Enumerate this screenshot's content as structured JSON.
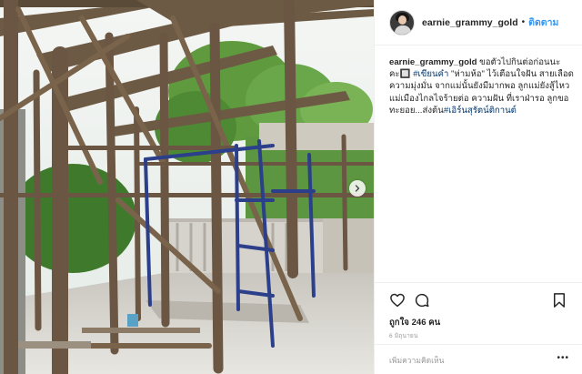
{
  "post": {
    "username": "earnie_grammy_gold",
    "separator": "•",
    "follow_label": "ติดตาม",
    "caption": {
      "user": "earnie_grammy_gold",
      "text_1": " ขอตัวไปกินต่อก่อนนะคะ🔲 ",
      "tag_1": "#เขียนคำ",
      "text_2": " \"ห่ามห้อ\" ไว้เตือนใจฝัน สายเลือดความมุ่งมั่น จากแม่นั้นยังมีมากพอ ลูกแม่ยังสู้ไหว แม่เมืองไกลไจร้ายต่อ ความฝัน ที่เราฝ่ารอ ลูกขอทะยอย...ส่งต้น",
      "tag_2": "#เอิร์นสุรัตน์ติกานต์"
    },
    "likes_text": "ถูกใจ 246 คน",
    "date_text": "6 มิถุนายน",
    "comment_placeholder": "เพิ่มความคิดเห็น",
    "more_label": "•••"
  },
  "icons": {
    "like": "heart-icon",
    "comment": "comment-bubble-icon",
    "save": "bookmark-icon",
    "next": "chevron-right-icon"
  },
  "colors": {
    "follow": "#3897f0",
    "hashtag": "#003569",
    "muted": "#999999",
    "border": "#efefef"
  }
}
